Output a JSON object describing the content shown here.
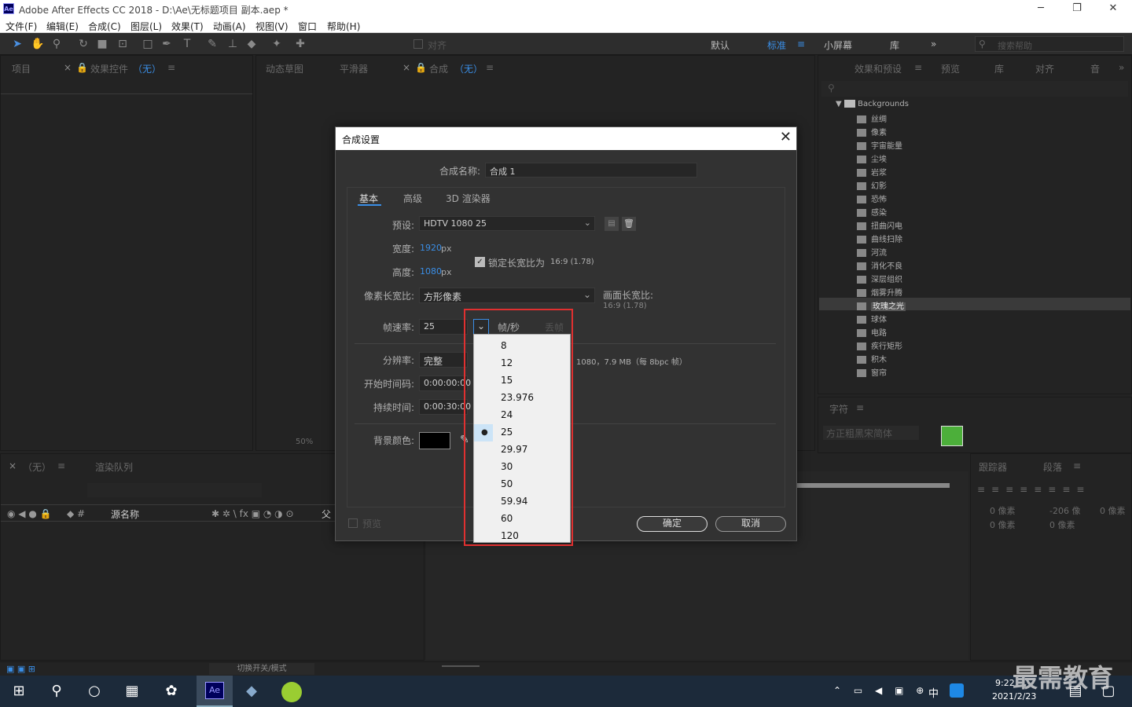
{
  "window": {
    "title": "Adobe After Effects CC 2018 - D:\\Ae\\无标题项目 副本.aep *",
    "logo": "Ae"
  },
  "menu": [
    "文件(F)",
    "编辑(E)",
    "合成(C)",
    "图层(L)",
    "效果(T)",
    "动画(A)",
    "视图(V)",
    "窗口",
    "帮助(H)"
  ],
  "toolbar": {
    "snap_label": "对齐",
    "workspaces": [
      "默认",
      "标准",
      "小屏幕",
      "库"
    ],
    "search_placeholder": "搜索帮助"
  },
  "panels": {
    "project": "项目",
    "effect_controls": "效果控件",
    "effect_controls_sub": "（无）",
    "motion_sketch": "动态草图",
    "smoother": "平滑器",
    "comp": "合成",
    "comp_sub": "（无）",
    "zoom": "50%",
    "effects_presets": "效果和预设",
    "preview": "预览",
    "library": "库",
    "align": "对齐",
    "audio": "音",
    "character": "字符",
    "font": "方正粗黑宋简体",
    "tracker": "跟踪器",
    "paragraph": "段落",
    "para_vals": [
      "0 像素",
      "-206 像",
      "0 像素",
      "0 像素",
      "0 像素"
    ],
    "timeline_tab": "（无）",
    "render_queue": "渲染队列",
    "source_name": "源名称",
    "parent": "父",
    "toggle_switches": "切换开关/模式"
  },
  "effects_tree": {
    "folder": "Backgrounds",
    "items": [
      "丝绸",
      "像素",
      "宇宙能量",
      "尘埃",
      "岩浆",
      "幻影",
      "恐怖",
      "感染",
      "扭曲闪电",
      "曲线扫除",
      "河流",
      "消化不良",
      "深层组织",
      "烟雾升腾",
      "玫瑰之光",
      "球体",
      "电路",
      "疾行矩形",
      "积木",
      "窗帘"
    ],
    "selected": "玫瑰之光"
  },
  "dialog": {
    "title": "合成设置",
    "name_label": "合成名称:",
    "name_value": "合成 1",
    "tabs": [
      "基本",
      "高级",
      "3D 渲染器"
    ],
    "preset_label": "预设:",
    "preset_value": "HDTV 1080 25",
    "width_label": "宽度:",
    "width_value": "1920",
    "height_label": "高度:",
    "height_value": "1080",
    "px": "px",
    "lock_label": "锁定长宽比为",
    "lock_ratio": "16:9 (1.78)",
    "par_label": "像素长宽比:",
    "par_value": "方形像素",
    "frame_aspect_label": "画面长宽比:",
    "frame_aspect_value": "16:9 (1.78)",
    "fps_label": "帧速率:",
    "fps_value": "25",
    "fps_unit": "帧/秒",
    "drop_frame": "丢帧",
    "res_label": "分辨率:",
    "res_value": "完整",
    "res_info": "1080，7.9 MB（每 8bpc 帧）",
    "start_label": "开始时间码:",
    "start_value": "0:00:00:00",
    "dur_label": "持续时间:",
    "dur_value": "0:00:30:00",
    "bg_label": "背景颜色:",
    "bg_color": "#000000",
    "preview_label": "预览",
    "ok": "确定",
    "cancel": "取消"
  },
  "fps_options": [
    "8",
    "12",
    "15",
    "23.976",
    "24",
    "25",
    "29.97",
    "30",
    "50",
    "59.94",
    "60",
    "120"
  ],
  "fps_selected": "25",
  "taskbar": {
    "time": "9:22",
    "date": "2021/2/23",
    "ime": "中"
  },
  "watermark": "最需教育"
}
